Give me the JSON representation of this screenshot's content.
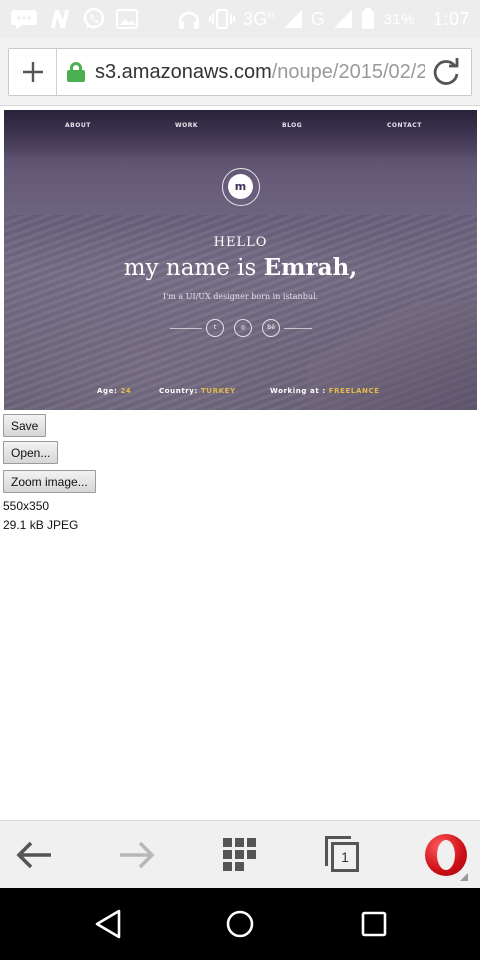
{
  "status_bar": {
    "network": "3G",
    "network_sup": "H",
    "carrier_signal": "G",
    "battery": "31%",
    "time": "1:07"
  },
  "address_bar": {
    "url_host": "s3.amazonaws.com",
    "url_path": "/noupe/2015/02/2"
  },
  "hero_image": {
    "nav": [
      "ABOUT",
      "WORK",
      "BLOG",
      "CONTACT"
    ],
    "logo_letter": "m",
    "hello": "HELLO",
    "headline_prefix": "my name is ",
    "headline_name": "Emrah,",
    "subline": "I'm a UI/UX designer born in istanbul.",
    "social_icons": [
      "twitter-icon",
      "dribbble-icon",
      "behance-icon"
    ],
    "social_labels": [
      "t",
      "◎",
      "Bē"
    ],
    "age_label": "Age:",
    "age_value": "24",
    "country_label": "Country:",
    "country_value": "TURKEY",
    "working_label": "Working at :",
    "working_value": "FREELANCE",
    "accent_color": "#e6b84a"
  },
  "actions": {
    "save": "Save",
    "open": "Open...",
    "zoom": "Zoom image..."
  },
  "image_info": {
    "dimensions": "550x350",
    "size_type": "29.1 kB  JPEG"
  },
  "bottom_bar": {
    "tab_count": "1",
    "brand_color": "#cc0f16"
  }
}
